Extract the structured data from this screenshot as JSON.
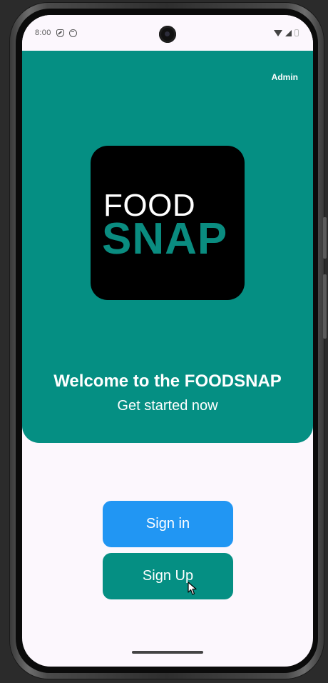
{
  "status_bar": {
    "time": "8:00",
    "left_icons": [
      "shield-icon",
      "face-icon"
    ],
    "right_icons": [
      "wifi-icon",
      "signal-icon",
      "battery-icon"
    ]
  },
  "header": {
    "admin_label": "Admin",
    "background_color": "#058f83"
  },
  "logo": {
    "line1": "FOOD",
    "line2": "SNAP",
    "background_color": "#000000",
    "accent_color": "#0a8c80"
  },
  "welcome": {
    "title": "Welcome to the FOODSNAP",
    "subtitle": "Get started now"
  },
  "actions": {
    "sign_in_label": "Sign in",
    "sign_in_color": "#2196f3",
    "sign_up_label": "Sign Up",
    "sign_up_color": "#058f83"
  }
}
